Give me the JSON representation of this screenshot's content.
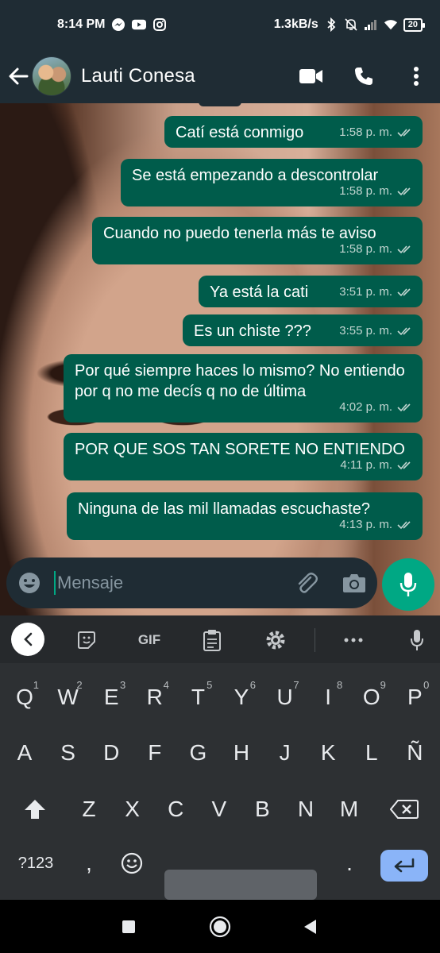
{
  "status_bar": {
    "time": "8:14 PM",
    "net_speed": "1.3kB/s",
    "battery": "20"
  },
  "header": {
    "contact_name": "Lauti Conesa"
  },
  "messages": [
    {
      "text": "Catí está conmigo",
      "time": "1:58 p. m."
    },
    {
      "text": "Se está empezando a descontrolar",
      "time": "1:58 p. m."
    },
    {
      "text": "Cuando no puedo tenerla más te aviso",
      "time": "1:58 p. m."
    },
    {
      "text": "Ya está la cati",
      "time": "3:51 p. m."
    },
    {
      "text": "Es un chiste ???",
      "time": "3:55 p. m."
    },
    {
      "text": "Por qué siempre haces lo mismo? No entiendo por q no me decís q no de última",
      "time": "4:02 p. m."
    },
    {
      "text": "POR QUE SOS TAN SORETE NO ENTIENDO",
      "time": "4:11 p. m."
    },
    {
      "text": "Ninguna de las mil llamadas escuchaste?",
      "time": "4:13 p. m."
    }
  ],
  "input": {
    "placeholder": "Mensaje"
  },
  "keyboard": {
    "row1": [
      {
        "key": "Q",
        "hint": "1"
      },
      {
        "key": "W",
        "hint": "2"
      },
      {
        "key": "E",
        "hint": "3"
      },
      {
        "key": "R",
        "hint": "4"
      },
      {
        "key": "T",
        "hint": "5"
      },
      {
        "key": "Y",
        "hint": "6"
      },
      {
        "key": "U",
        "hint": "7"
      },
      {
        "key": "I",
        "hint": "8"
      },
      {
        "key": "O",
        "hint": "9"
      },
      {
        "key": "P",
        "hint": "0"
      }
    ],
    "row2": [
      "A",
      "S",
      "D",
      "F",
      "G",
      "H",
      "J",
      "K",
      "L",
      "Ñ"
    ],
    "row3": [
      "Z",
      "X",
      "C",
      "V",
      "B",
      "N",
      "M"
    ],
    "symbols_label": "?123",
    "comma": ",",
    "period": ".",
    "gif_label": "GIF"
  },
  "colors": {
    "bubble_out": "#005c4b",
    "accent": "#00a884",
    "bar": "#1f2c34"
  }
}
